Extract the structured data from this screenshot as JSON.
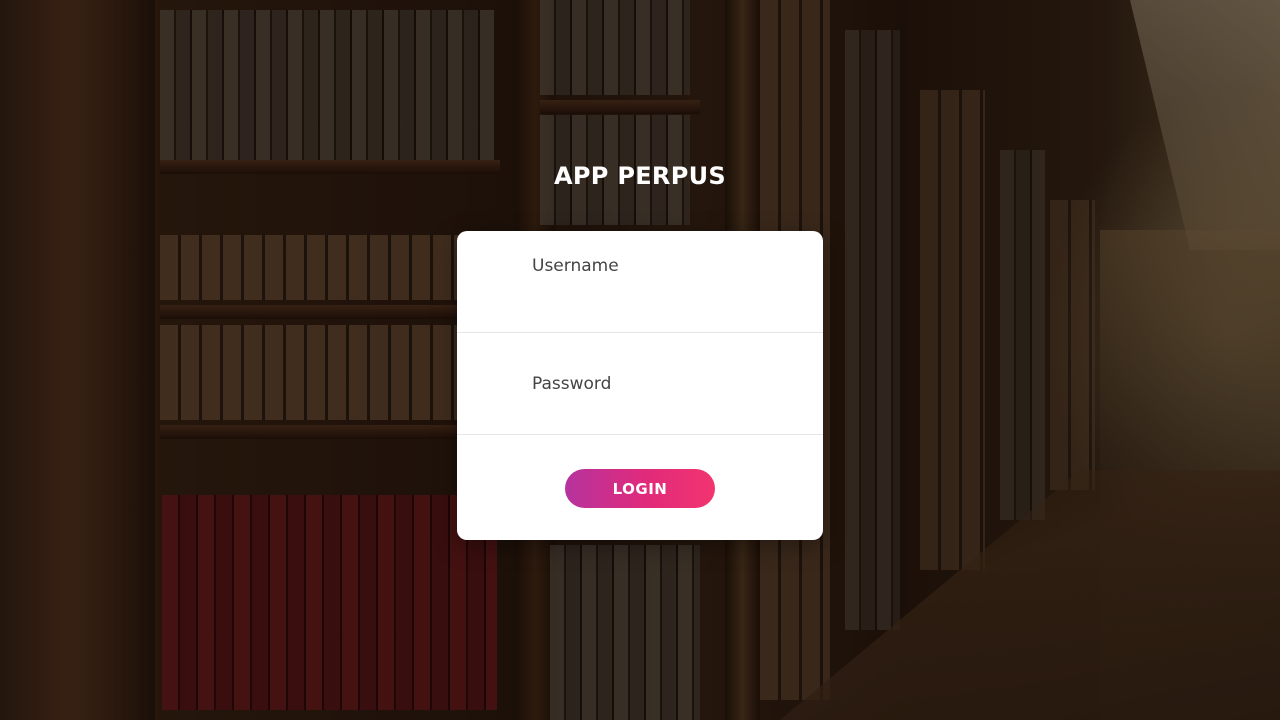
{
  "app": {
    "title": "APP PERPUS"
  },
  "login_form": {
    "username": {
      "placeholder": "Username",
      "value": ""
    },
    "password": {
      "placeholder": "Password",
      "value": ""
    },
    "submit_label": "LOGIN"
  },
  "colors": {
    "button_gradient_start": "#b6339e",
    "button_gradient_end": "#f2346f",
    "card_background": "#ffffff",
    "title_color": "#ffffff"
  }
}
